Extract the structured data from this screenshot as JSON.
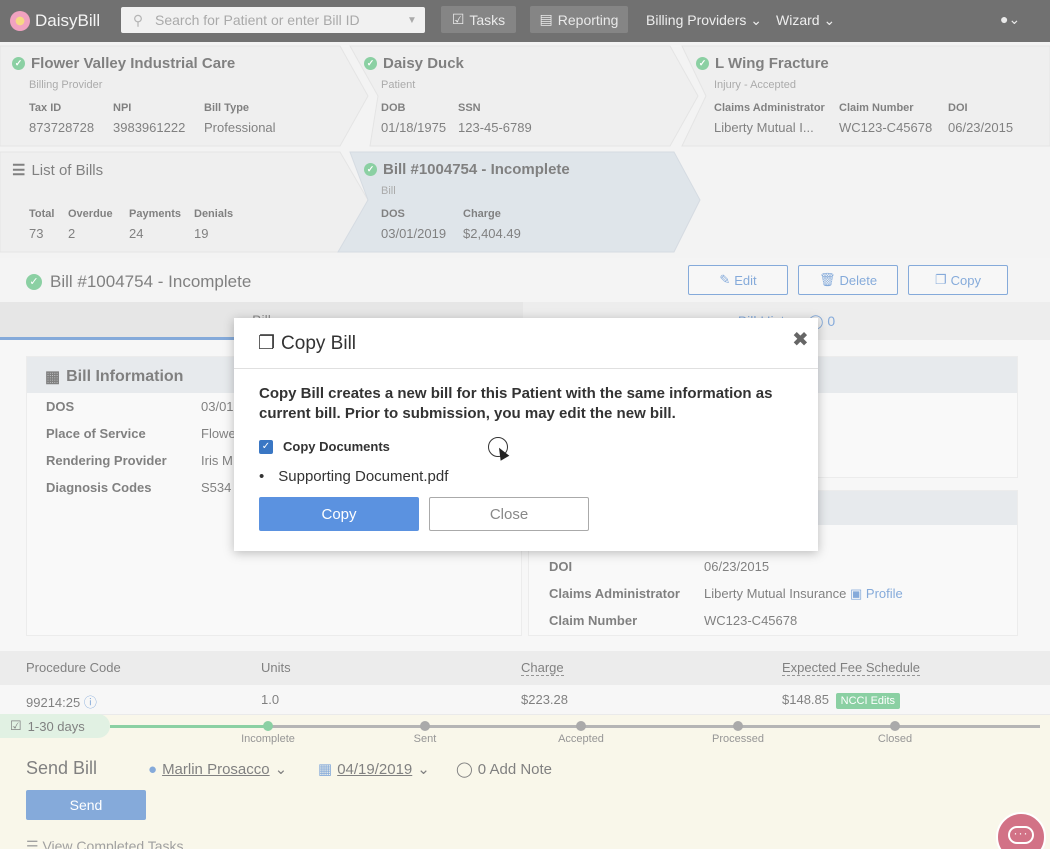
{
  "app": {
    "name": "DaisyBill"
  },
  "nav": {
    "search_placeholder": "Search for Patient or enter Bill ID",
    "tasks": "Tasks",
    "reporting": "Reporting",
    "billing_providers": "Billing Providers",
    "wizard": "Wizard"
  },
  "provider": {
    "title": "Flower Valley Industrial Care",
    "sub": "Billing Provider",
    "fields": [
      {
        "label": "Tax ID",
        "value": "873728728"
      },
      {
        "label": "NPI",
        "value": "3983961222"
      },
      {
        "label": "Bill Type",
        "value": "Professional"
      }
    ]
  },
  "patient": {
    "title": "Daisy Duck",
    "sub": "Patient",
    "fields": [
      {
        "label": "DOB",
        "value": "01/18/1975"
      },
      {
        "label": "SSN",
        "value": "123-45-6789"
      }
    ]
  },
  "injury": {
    "title": "L Wing Fracture",
    "sub": "Injury - Accepted",
    "fields": [
      {
        "label": "Claims Administrator",
        "value": "Liberty Mutual I..."
      },
      {
        "label": "Claim Number",
        "value": "WC123-C45678"
      },
      {
        "label": "DOI",
        "value": "06/23/2015"
      }
    ]
  },
  "bills_list": {
    "title": "List of Bills",
    "fields": [
      {
        "label": "Total",
        "value": "73"
      },
      {
        "label": "Overdue",
        "value": "2"
      },
      {
        "label": "Payments",
        "value": "24"
      },
      {
        "label": "Denials",
        "value": "19"
      }
    ]
  },
  "bill_card": {
    "title": "Bill #1004754 - Incomplete",
    "sub": "Bill",
    "fields": [
      {
        "label": "DOS",
        "value": "03/01/2019"
      },
      {
        "label": "Charge",
        "value": "$2,404.49"
      }
    ]
  },
  "bill_header": {
    "title": "Bill #1004754 - Incomplete",
    "edit": "Edit",
    "delete": "Delete",
    "copy": "Copy"
  },
  "tabs": {
    "bill": "Bill",
    "history": "Bill History",
    "history_count": "0"
  },
  "bill_info": {
    "title": "Bill Information",
    "rows": [
      {
        "label": "DOS",
        "value": "03/01"
      },
      {
        "label": "Place of Service",
        "value": "Flowe"
      },
      {
        "label": "Rendering Provider",
        "value": "Iris M"
      },
      {
        "label": "Diagnosis Codes",
        "value": "S534"
      }
    ]
  },
  "claim_info": {
    "rows": [
      {
        "label": "DOI",
        "value": "06/23/2015"
      },
      {
        "label": "Claims Administrator",
        "value": "Liberty Mutual Insurance",
        "link": "Profile"
      },
      {
        "label": "Claim Number",
        "value": "WC123-C45678"
      }
    ]
  },
  "procedures": {
    "headers": [
      "Procedure Code",
      "Units",
      "Charge",
      "Expected Fee Schedule"
    ],
    "rows": [
      {
        "code": "99214:25",
        "units": "1.0",
        "charge": "$223.28",
        "expected": "$148.85",
        "badge": "NCCI Edits"
      }
    ]
  },
  "task": {
    "days": "1-30 days",
    "steps": [
      "Incomplete",
      "Sent",
      "Accepted",
      "Processed",
      "Closed"
    ],
    "title": "Send Bill",
    "assignee": "Marlin Prosacco",
    "date": "04/19/2019",
    "note": "0 Add Note",
    "send": "Send",
    "completed": "View Completed Tasks"
  },
  "modal": {
    "title": "Copy Bill",
    "description": "Copy Bill creates a new bill for this Patient with the same information as current bill. Prior to submission, you may edit the new bill.",
    "checkbox_label": "Copy Documents",
    "checked": true,
    "documents": [
      "Supporting Document.pdf"
    ],
    "copy": "Copy",
    "close": "Close"
  },
  "colors": {
    "accent": "#3a77c4",
    "success": "#45b36b",
    "nav": "#1b1b1b"
  }
}
